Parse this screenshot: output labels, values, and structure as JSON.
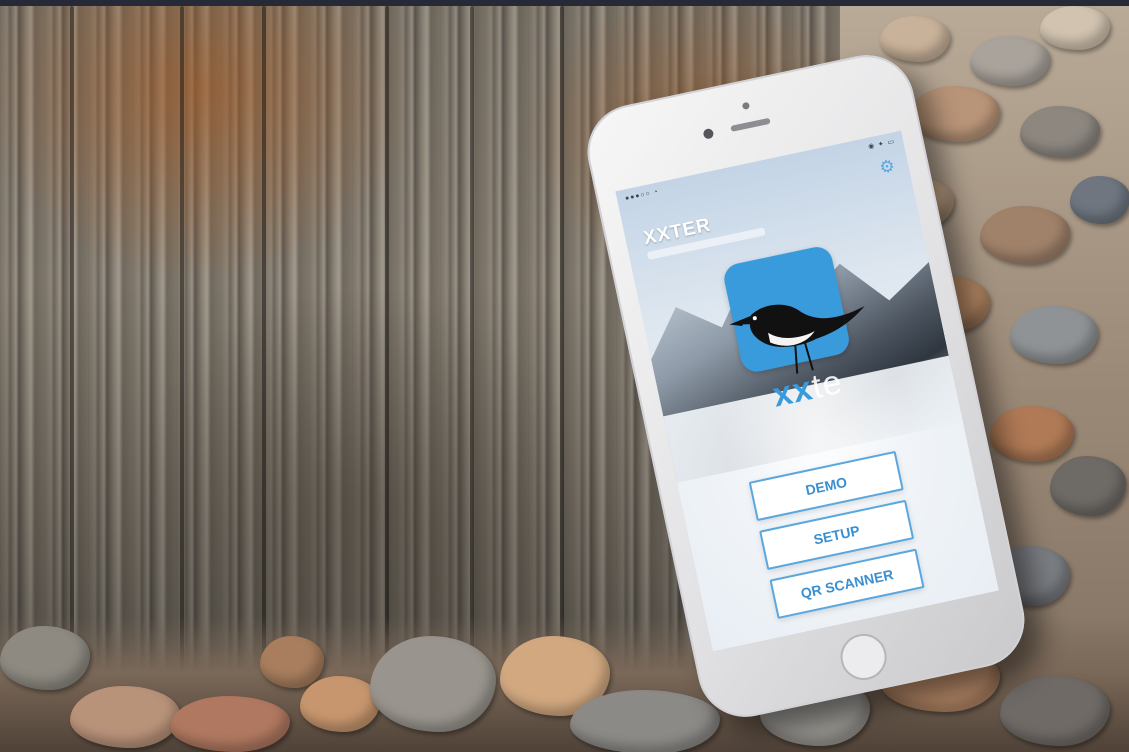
{
  "app": {
    "title": "XXTER"
  },
  "buttons": {
    "demo": "DEMO",
    "setup": "SETUP",
    "qr_scanner": "QR SCANNER"
  },
  "logo": {
    "text_prefix": "xx",
    "text_suffix": "te",
    "tile_color": "#3a9bdc"
  },
  "icons": {
    "settings": "gear-icon",
    "mascot": "bird-icon"
  },
  "colors": {
    "accent": "#5aa7e0",
    "button_text": "#3a8fd0",
    "phone_body": "#e6e6e8"
  }
}
